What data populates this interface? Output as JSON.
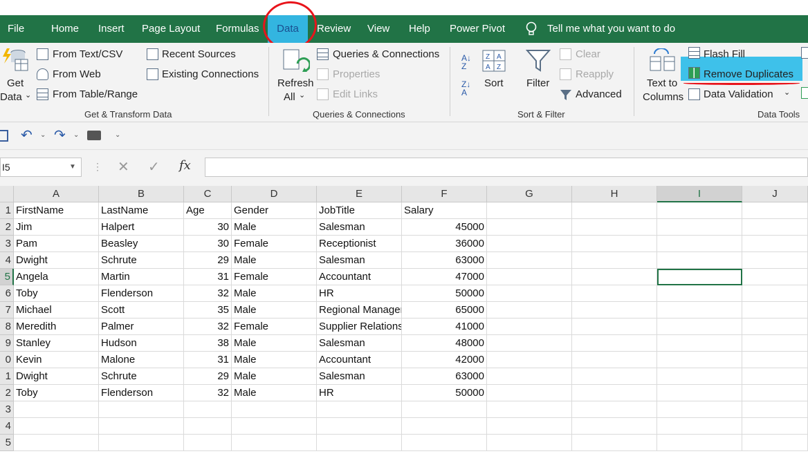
{
  "tabs": [
    "File",
    "Home",
    "Insert",
    "Page Layout",
    "Formulas",
    "Data",
    "Review",
    "View",
    "Help",
    "Power Pivot"
  ],
  "tell_me": "Tell me what you want to do",
  "ribbon": {
    "get_transform": {
      "get_data_1": "Get",
      "get_data_2": "Data",
      "from_text": "From Text/CSV",
      "from_web": "From Web",
      "from_table": "From Table/Range",
      "recent_sources": "Recent Sources",
      "existing_connections": "Existing Connections",
      "label": "Get & Transform Data"
    },
    "queries": {
      "refresh_1": "Refresh",
      "refresh_2": "All",
      "queries_connections": "Queries & Connections",
      "properties": "Properties",
      "edit_links": "Edit Links",
      "label": "Queries & Connections"
    },
    "sort_filter": {
      "sort": "Sort",
      "filter": "Filter",
      "clear": "Clear",
      "reapply": "Reapply",
      "advanced": "Advanced",
      "label": "Sort & Filter"
    },
    "data_tools": {
      "text_to_1": "Text to",
      "text_to_2": "Columns",
      "flash_fill": "Flash Fill",
      "remove_duplicates": "Remove Duplicates",
      "data_validation": "Data Validation",
      "label": "Data Tools"
    }
  },
  "name_box": "I5",
  "columns": [
    "A",
    "B",
    "C",
    "D",
    "E",
    "F",
    "G",
    "H",
    "I",
    "J"
  ],
  "row_numbers": [
    "1",
    "2",
    "3",
    "4",
    "5",
    "6",
    "7",
    "8",
    "9",
    "0",
    "1",
    "2",
    "3",
    "4",
    "5"
  ],
  "table": [
    [
      "FirstName",
      "LastName",
      "Age",
      "Gender",
      "JobTitle",
      "Salary"
    ],
    [
      "Jim",
      "Halpert",
      "30",
      "Male",
      "Salesman",
      "45000"
    ],
    [
      "Pam",
      "Beasley",
      "30",
      "Female",
      "Receptionist",
      "36000"
    ],
    [
      "Dwight",
      "Schrute",
      "29",
      "Male",
      "Salesman",
      "63000"
    ],
    [
      "Angela",
      "Martin",
      "31",
      "Female",
      "Accountant",
      "47000"
    ],
    [
      "Toby",
      "Flenderson",
      "32",
      "Male",
      "HR",
      "50000"
    ],
    [
      "Michael",
      "Scott",
      "35",
      "Male",
      "Regional Manager",
      "65000"
    ],
    [
      "Meredith",
      "Palmer",
      "32",
      "Female",
      "Supplier Relations",
      "41000"
    ],
    [
      "Stanley",
      "Hudson",
      "38",
      "Male",
      "Salesman",
      "48000"
    ],
    [
      "Kevin",
      "Malone",
      "31",
      "Male",
      "Accountant",
      "42000"
    ],
    [
      "Dwight",
      "Schrute",
      "29",
      "Male",
      "Salesman",
      "63000"
    ],
    [
      "Toby",
      "Flenderson",
      "32",
      "Male",
      "HR",
      "50000"
    ]
  ],
  "colors": {
    "excel_green": "#217346",
    "highlight": "#3ec1ea",
    "annotation_red": "#e8141b"
  }
}
